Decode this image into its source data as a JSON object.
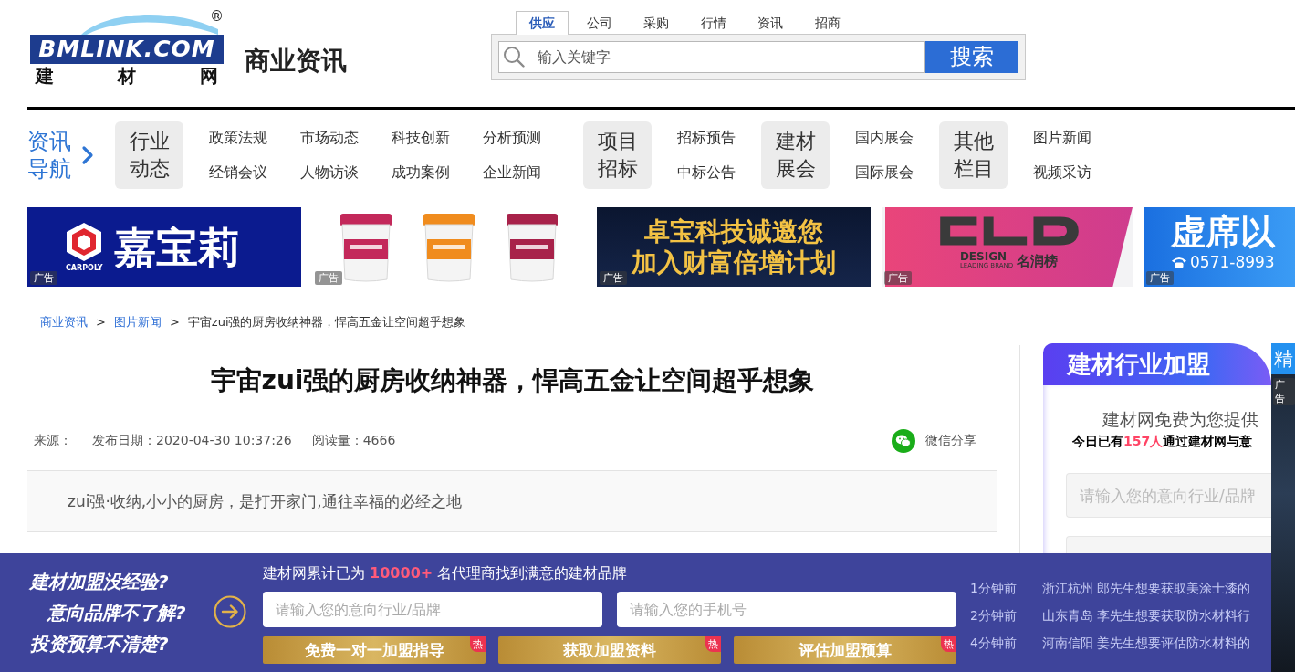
{
  "logo": {
    "wordmark": "BMLINK.COM",
    "registered": "®",
    "subtitle": "建材网"
  },
  "section_title": "商业资讯",
  "search": {
    "tabs": [
      {
        "label": "供应",
        "selected": true
      },
      {
        "label": "公司",
        "selected": false
      },
      {
        "label": "采购",
        "selected": false
      },
      {
        "label": "行情",
        "selected": false
      },
      {
        "label": "资讯",
        "selected": false
      },
      {
        "label": "招商",
        "selected": false
      }
    ],
    "placeholder": "输入关键字",
    "button": "搜索"
  },
  "nav": {
    "title": "资讯导航",
    "groups": [
      {
        "heading": "行业动态",
        "links": [
          "政策法规",
          "市场动态",
          "科技创新",
          "分析预测",
          "经销会议",
          "人物访谈",
          "成功案例",
          "企业新闻"
        ]
      },
      {
        "heading": "项目招标",
        "links": [
          "招标预告",
          "中标公告"
        ]
      },
      {
        "heading": "建材展会",
        "links": [
          "国内展会",
          "国际展会"
        ]
      },
      {
        "heading": "其他栏目",
        "links": [
          "图片新闻",
          "视频采访"
        ]
      }
    ]
  },
  "ads": [
    {
      "kind": "brand",
      "brand": "CARPOLY",
      "title": "嘉宝莉",
      "label": "广告"
    },
    {
      "kind": "products",
      "label": "广告"
    },
    {
      "kind": "slogan",
      "lines": [
        "卓宝科技诚邀您",
        "加入财富倍增计划"
      ],
      "label": "广告"
    },
    {
      "kind": "design",
      "brand": "DESIGN",
      "tagline": "LEADING BRAND",
      "name": "名润榜",
      "label": "广告"
    },
    {
      "kind": "phone",
      "title": "虚席以",
      "phone": "0571-8993",
      "label": "广告"
    }
  ],
  "breadcrumb": [
    {
      "kind": "link",
      "label": "商业资讯"
    },
    {
      "kind": "separator",
      "label": ">"
    },
    {
      "kind": "link",
      "label": "图片新闻"
    },
    {
      "kind": "separator",
      "label": ">"
    },
    {
      "kind": "current",
      "label": "宇宙zui强的厨房收纳神器，悍高五金让空间超乎想象"
    }
  ],
  "article": {
    "title": "宇宙zui强的厨房收纳神器，悍高五金让空间超乎想象",
    "meta": [
      "来源：",
      "发布日期：2020-04-30 10:37:26",
      "阅读量：4666"
    ],
    "share": "微信分享",
    "summary": "zui强·收纳,小小的厨房，是打开家门,通往幸福的必经之地"
  },
  "join_panel": {
    "title": "建材行业加盟",
    "intro": "建材网免费为您提供",
    "count_line": {
      "before": "今日已有",
      "highlight": "157人",
      "after": "通过建材网与意"
    },
    "fields": [
      {
        "kind": "field",
        "placeholder": "请输入您的意向行业/品牌"
      },
      {
        "kind": "partial"
      }
    ]
  },
  "side_ad": {
    "title": "精",
    "label": "广告"
  },
  "bottom_bar": {
    "questions": [
      "建材加盟没经验?",
      "意向品牌不了解?",
      "投资预算不清楚?"
    ],
    "headline": {
      "before": "建材网累计已为 ",
      "highlight": "10000+",
      "after": " 名代理商找到满意的建材品牌"
    },
    "fields": [
      {
        "placeholder": "请输入您的意向行业/品牌"
      },
      {
        "placeholder": "请输入您的手机号"
      }
    ],
    "buttons": [
      {
        "label": "免费一对一加盟指导",
        "tag": "热"
      },
      {
        "label": "获取加盟资料",
        "tag": "热"
      },
      {
        "label": "评估加盟预算",
        "tag": "热"
      }
    ],
    "feed": [
      {
        "time": "1分钟前",
        "text": "浙江杭州 郎先生想要获取美涂士漆的"
      },
      {
        "time": "2分钟前",
        "text": "山东青岛 李先生想要获取防水材料行"
      },
      {
        "time": "4分钟前",
        "text": "河南信阳 姜先生想要评估防水材料的"
      }
    ]
  }
}
